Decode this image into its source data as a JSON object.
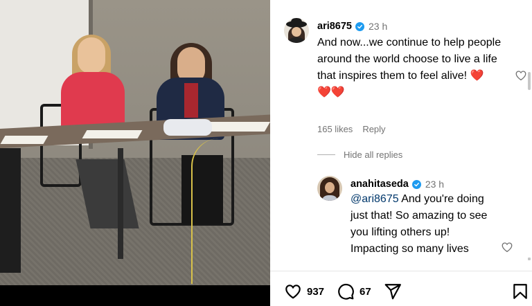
{
  "comments": [
    {
      "username": "ari8675",
      "time": "23 h",
      "text": "And now...we continue to help people around the world choose to live a life that inspires them to feel alive!",
      "emoji_inline": "❤️",
      "emoji_line": "❤️❤️",
      "likes": "165 likes",
      "reply_label": "Reply"
    }
  ],
  "hide_replies_label": "Hide all replies",
  "replies": [
    {
      "username": "anahitaseda",
      "time": "23 h",
      "mention": "@ari8675",
      "text": "And you're doing just that! So amazing to see you lifting others up! Impacting so many lives"
    }
  ],
  "actions": {
    "likes_count": "937",
    "comments_count": "67"
  },
  "icons": {
    "verified": "verified-badge-icon",
    "like": "heart-outline-icon",
    "comment": "speech-bubble-icon",
    "share": "paper-plane-icon",
    "save": "bookmark-icon"
  },
  "colors": {
    "verified": "#1d9bf0",
    "meta_gray": "#737373",
    "mention": "#00376b",
    "heart_red": "#d9233a"
  }
}
